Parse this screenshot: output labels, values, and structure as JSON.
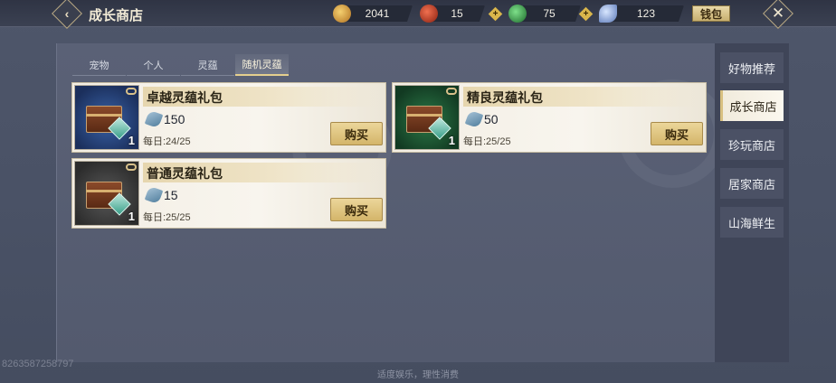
{
  "header": {
    "title": "成长商店",
    "wallet_label": "钱包",
    "currencies": [
      {
        "icon": "gold-coin-icon",
        "value": "2041",
        "color": "#e0a040"
      },
      {
        "icon": "red-orb-icon",
        "value": "15",
        "color": "#c84830"
      },
      {
        "icon": "jade-dragon-icon",
        "value": "75",
        "color": "#3aa858"
      },
      {
        "icon": "spirit-jade-icon",
        "value": "123",
        "color": "#8fa8d8"
      }
    ]
  },
  "tabs": [
    {
      "label": "宠物",
      "active": false
    },
    {
      "label": "个人",
      "active": false
    },
    {
      "label": "灵蕴",
      "active": false
    },
    {
      "label": "随机灵蕴",
      "active": true
    }
  ],
  "items": [
    {
      "name": "卓越灵蕴礼包",
      "price": "150",
      "daily": "每日:24/25",
      "qty": "1",
      "buy_label": "购买",
      "rarity": "blue"
    },
    {
      "name": "精良灵蕴礼包",
      "price": "50",
      "daily": "每日:25/25",
      "qty": "1",
      "buy_label": "购买",
      "rarity": "green"
    },
    {
      "name": "普通灵蕴礼包",
      "price": "15",
      "daily": "每日:25/25",
      "qty": "1",
      "buy_label": "购买",
      "rarity": "gray"
    }
  ],
  "sidenav": [
    {
      "label": "好物推荐",
      "active": false
    },
    {
      "label": "成长商店",
      "active": true
    },
    {
      "label": "珍玩商店",
      "active": false
    },
    {
      "label": "居家商店",
      "active": false
    },
    {
      "label": "山海鲜生",
      "active": false
    }
  ],
  "footer": {
    "note": "适度娱乐，理性消费",
    "watermark": "8263587258797"
  }
}
